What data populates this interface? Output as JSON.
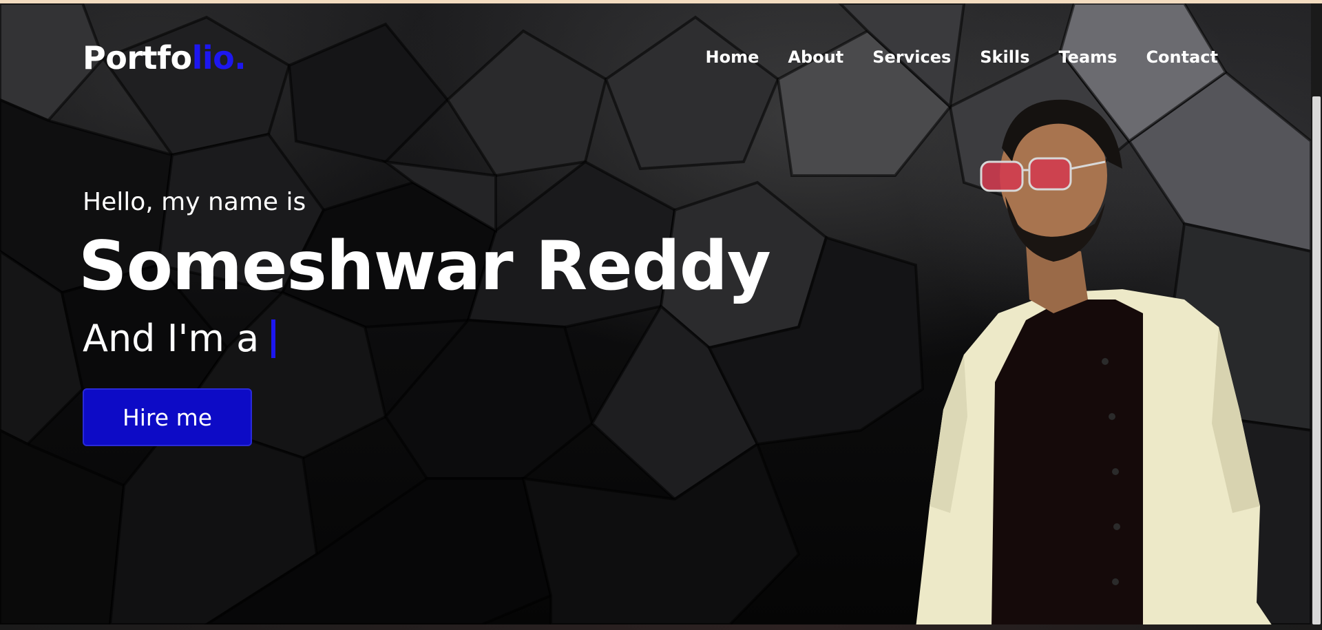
{
  "brand": {
    "logo_main": "Portfo",
    "logo_accent": "lio.",
    "accent_color": "#1d17f0"
  },
  "nav": {
    "items": [
      {
        "label": "Home"
      },
      {
        "label": "About"
      },
      {
        "label": "Services"
      },
      {
        "label": "Skills"
      },
      {
        "label": "Teams"
      },
      {
        "label": "Contact"
      }
    ]
  },
  "hero": {
    "greeting": "Hello, my name is",
    "name": "Someshwar Reddy",
    "role_prefix": "And I'm a",
    "hire_button_label": "Hire me",
    "button_color": "#0d0bc6"
  }
}
